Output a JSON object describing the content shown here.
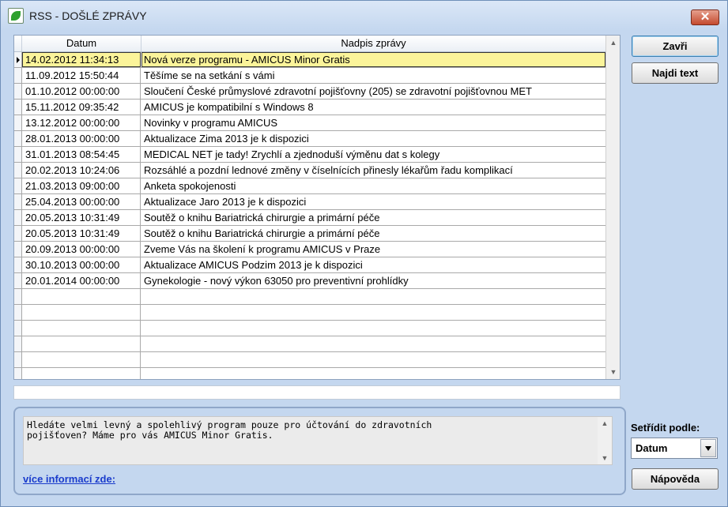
{
  "window": {
    "title": "RSS - DOŠLÉ ZPRÁVY",
    "close_glyph": "✕"
  },
  "grid": {
    "columns": {
      "date": "Datum",
      "title": "Nadpis zprávy"
    },
    "rows": [
      {
        "date": "14.02.2012 11:34:13",
        "title": "Nová verze programu - AMICUS Minor Gratis"
      },
      {
        "date": "11.09.2012 15:50:44",
        "title": "Těšíme se na setkání s vámi"
      },
      {
        "date": "01.10.2012 00:00:00",
        "title": "Sloučení České průmyslové zdravotní pojišťovny (205) se zdravotní pojišťovnou MET"
      },
      {
        "date": "15.11.2012 09:35:42",
        "title": "AMICUS je kompatibilní s Windows 8"
      },
      {
        "date": "13.12.2012 00:00:00",
        "title": "Novinky v programu AMICUS"
      },
      {
        "date": "28.01.2013 00:00:00",
        "title": "Aktualizace Zima 2013 je k dispozici"
      },
      {
        "date": "31.01.2013 08:54:45",
        "title": "MEDICAL NET je tady! Zrychlí a zjednoduší výměnu dat s kolegy"
      },
      {
        "date": "20.02.2013 10:24:06",
        "title": "Rozsáhlé a pozdní lednové změny v číselnících přinesly lékařům řadu komplikací"
      },
      {
        "date": "21.03.2013 09:00:00",
        "title": "Anketa spokojenosti"
      },
      {
        "date": "25.04.2013 00:00:00",
        "title": "Aktualizace Jaro 2013 je k dispozici"
      },
      {
        "date": "20.05.2013 10:31:49",
        "title": "Soutěž o knihu Bariatrická chirurgie a primární péče"
      },
      {
        "date": "20.05.2013 10:31:49",
        "title": "Soutěž o knihu Bariatrická chirurgie a primární péče"
      },
      {
        "date": "20.09.2013 00:00:00",
        "title": "Zveme Vás na školení k programu AMICUS v Praze"
      },
      {
        "date": "30.10.2013 00:00:00",
        "title": "Aktualizace AMICUS Podzim 2013 je k dispozici"
      },
      {
        "date": "20.01.2014 00:00:00",
        "title": "Gynekologie - nový výkon 63050 pro preventivní prohlídky"
      },
      {
        "date": "",
        "title": ""
      },
      {
        "date": "",
        "title": ""
      },
      {
        "date": "",
        "title": ""
      },
      {
        "date": "",
        "title": ""
      },
      {
        "date": "",
        "title": ""
      },
      {
        "date": "",
        "title": ""
      }
    ],
    "selected_index": 0,
    "selected_color": "#fbf49a"
  },
  "buttons": {
    "close": "Zavři",
    "find": "Najdi text",
    "help": "Nápověda"
  },
  "sort": {
    "label": "Setřídit podle:",
    "value": "Datum"
  },
  "description": {
    "text": "Hledáte velmi levný a spolehlivý program pouze pro účtování do zdravotních\npojišťoven? Máme pro vás AMICUS Minor Gratis.",
    "link": "více informací zde:"
  },
  "icons": {
    "app": "rss-app-icon",
    "scroll_up": "▲",
    "scroll_down": "▼"
  }
}
